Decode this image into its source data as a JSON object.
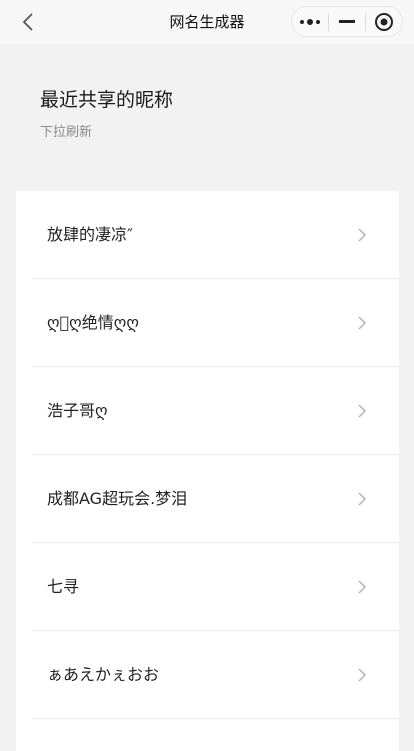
{
  "nav": {
    "title": "网名生成器",
    "back_icon": "chevron-left-icon",
    "menu_icon": "more-dots-icon",
    "minimize_icon": "minimize-icon",
    "close_icon": "target-close-icon"
  },
  "header": {
    "title": "最近共享的昵称",
    "subtitle": "下拉刷新"
  },
  "items": [
    {
      "label": "放肆的凄凉″"
    },
    {
      "label": "ღ⃢ღ绝情ღღ"
    },
    {
      "label": "浩子哥ღ"
    },
    {
      "label": "成都AG超玩会.梦泪"
    },
    {
      "label": "七寻"
    },
    {
      "label": "ぁあえかぇおお"
    }
  ],
  "colors": {
    "nav_bg": "#f7f7f7",
    "page_bg": "#f2f2f2",
    "card_bg": "#ffffff",
    "chevron": "#b5b5b5"
  }
}
